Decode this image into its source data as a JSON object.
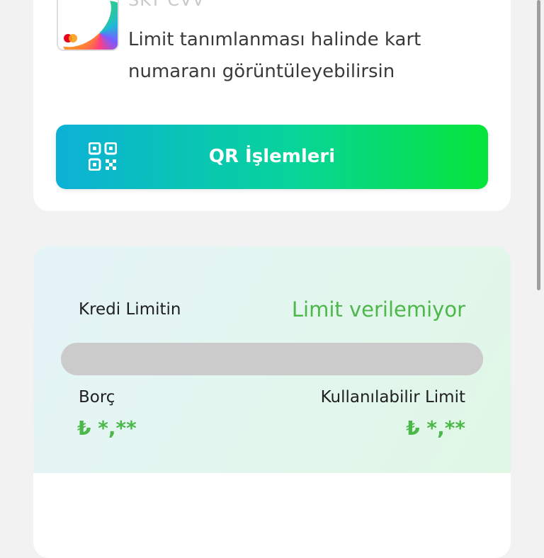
{
  "card": {
    "ghost_text": "SKT          CVV",
    "description": "Limit tanımlanması halinde kart numaranı görüntüleyebilirsin",
    "brand_icon": "mastercard-icon"
  },
  "qr_button": {
    "label": "QR İşlemleri",
    "icon": "qr-code-icon"
  },
  "credit": {
    "limit_label": "Kredi Limitin",
    "limit_status": "Limit verilemiyor",
    "usage_fraction": 0,
    "debt_label": "Borç",
    "debt_value": "₺ *,**",
    "available_label": "Kullanılabilir Limit",
    "available_value": "₺ *,**"
  },
  "colors": {
    "accent_green": "#4cb84a",
    "button_gradient_start": "#0cb1d6",
    "button_gradient_end": "#05e53a",
    "progress_track": "#cbcbcb"
  }
}
